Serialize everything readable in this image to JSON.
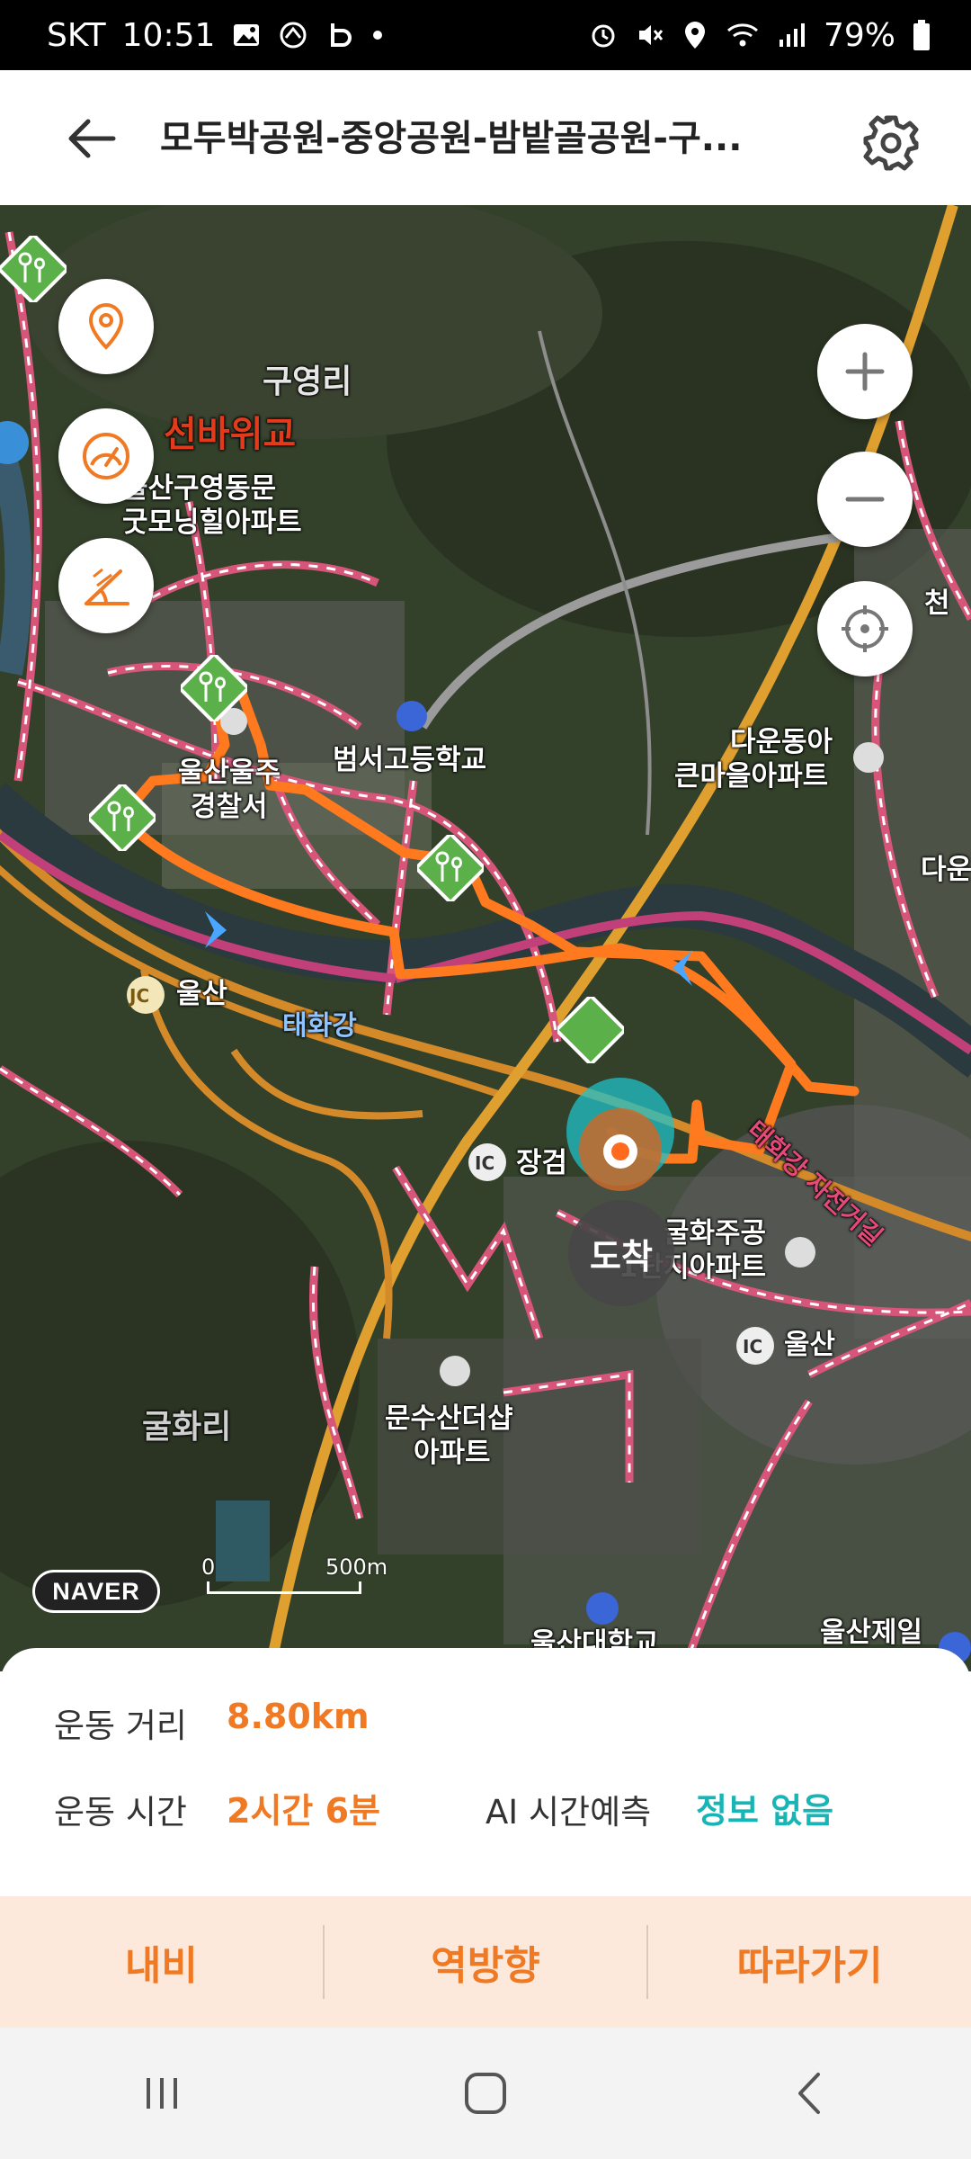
{
  "status_bar": {
    "carrier": "SKT",
    "time": "10:51",
    "battery": "79%"
  },
  "header": {
    "title": "모두박공원-중앙공원-밤밭골공원-구..."
  },
  "map": {
    "labels": {
      "guyeong_ri": "구영리",
      "seonbawi_bridge": "선바위교",
      "apt_line1": "울산구영동문",
      "apt_line2": "굿모닝힐아파트",
      "police_line1": "울산울주",
      "police_line2": "경찰서",
      "beomseo_school": "범서고등학교",
      "daun_line1": "다운동아",
      "daun_line2": "큰마을아파트",
      "daun_edge": "다운",
      "cheon_edge": "천",
      "ulsan_jc": "울산",
      "taehwa_river": "태화강",
      "janggeom": "장검",
      "gulhwa_apt_line1": "굴화주공",
      "gulhwa_apt_line2": "1단지아파트",
      "ulsan_ic": "울산",
      "gulhwa_ri": "굴화리",
      "munsusan_line1": "문수산더샵",
      "munsusan_line2": "아파트",
      "bike_path": "태화강 자전거길",
      "ulsan_univ": "울산대학교",
      "ulsan_jeil": "울산제일",
      "jc_badge": "JC",
      "ic_badge": "IC",
      "arrival": "도착"
    },
    "logo": "NAVER",
    "scale": {
      "zero": "0",
      "distance": "500m"
    },
    "route_color": "#ff7a1f"
  },
  "stats": {
    "distance_label": "운동 거리",
    "distance_value": "8.80km",
    "time_label": "운동 시간",
    "time_value": "2시간 6분",
    "ai_label": "AI 시간예측",
    "ai_value": "정보 없음"
  },
  "actions": {
    "navi": "내비",
    "reverse": "역방향",
    "follow": "따라가기"
  },
  "icons": [
    "image-icon",
    "app-icon",
    "b-icon",
    "alarm-icon",
    "mute-icon",
    "location-icon",
    "wifi-icon",
    "signal-icon",
    "battery-icon",
    "back-arrow-icon",
    "gear-icon",
    "location-pin-icon",
    "speedometer-icon",
    "angle-icon",
    "plus-icon",
    "minus-icon",
    "crosshair-icon",
    "park-marker-icon",
    "recent-apps-icon",
    "home-icon",
    "nav-back-icon"
  ]
}
